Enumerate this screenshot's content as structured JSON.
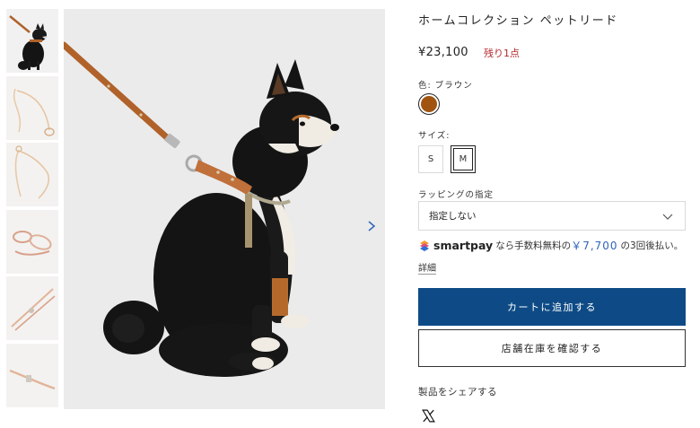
{
  "product": {
    "title": "ホームコレクション ペットリード",
    "price": "¥23,100",
    "stock_note": "残り1点"
  },
  "color": {
    "label": "色: ブラウン",
    "selected_swatch": "#a15410"
  },
  "size": {
    "label": "サイズ:",
    "options": [
      "S",
      "M"
    ],
    "selected": "M"
  },
  "wrapping": {
    "label": "ラッピングの指定",
    "value": "指定しない"
  },
  "smartpay": {
    "brand": "smartpay",
    "text_before": "なら手数料無料の",
    "amount": "￥7,700",
    "text_after": "の3回後払い。",
    "details_link": "詳細"
  },
  "actions": {
    "add_to_cart": "カートに追加する",
    "check_stock": "店舗在庫を確認する"
  },
  "share": {
    "label": "製品をシェアする",
    "icons": [
      "x-logo-icon"
    ]
  },
  "gallery": {
    "thumbnails": [
      "dog-with-leash",
      "leash-coiled",
      "leash-looped",
      "leash-tangled",
      "leash-diagonal",
      "leash-detail"
    ],
    "active_index": 0
  },
  "colors": {
    "accent": "#0e4b86",
    "stock": "#b3292c",
    "smartpay_amount": "#2f64b8",
    "leather": "#a15410"
  }
}
